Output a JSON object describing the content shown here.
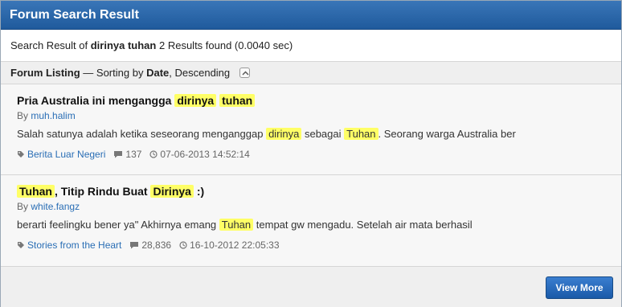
{
  "window": {
    "title": "Forum Search Result"
  },
  "summary": {
    "prefix": "Search Result of",
    "query": "dirinya tuhan",
    "suffix": "2 Results found (0.0040 sec)"
  },
  "listing": {
    "label": "Forum Listing",
    "sort_prefix": "— Sorting by",
    "sort_field": "Date",
    "sort_order": ", Descending"
  },
  "results": [
    {
      "title_parts": [
        "Pria Australia ini mengangga ",
        "dirinya",
        " ",
        "tuhan",
        ""
      ],
      "by_label": "By",
      "author": "muh.halim",
      "snippet_parts": [
        "Salah satunya adalah ketika seseorang menganggap ",
        "dirinya",
        " sebagai ",
        "Tuhan",
        ". Seorang warga Australia ber"
      ],
      "category": "Berita Luar Negeri",
      "replies": "137",
      "date": "07-06-2013 14:52:14"
    },
    {
      "title_parts": [
        "",
        "Tuhan",
        ", Titip Rindu Buat ",
        "Dirinya",
        " :)"
      ],
      "by_label": "By",
      "author": "white.fangz",
      "snippet_parts": [
        "berarti feelingku bener ya\" Akhirnya emang ",
        "Tuhan",
        " tempat gw mengadu. Setelah air mata berhasil",
        "",
        ""
      ],
      "category": "Stories from the Heart",
      "replies": "28,836",
      "date": "16-10-2012 22:05:33"
    }
  ],
  "footer": {
    "view_more_label": "View More"
  },
  "colors": {
    "header": "#1f5a9c",
    "highlight": "#ffff66",
    "link": "#2a6eb5"
  }
}
